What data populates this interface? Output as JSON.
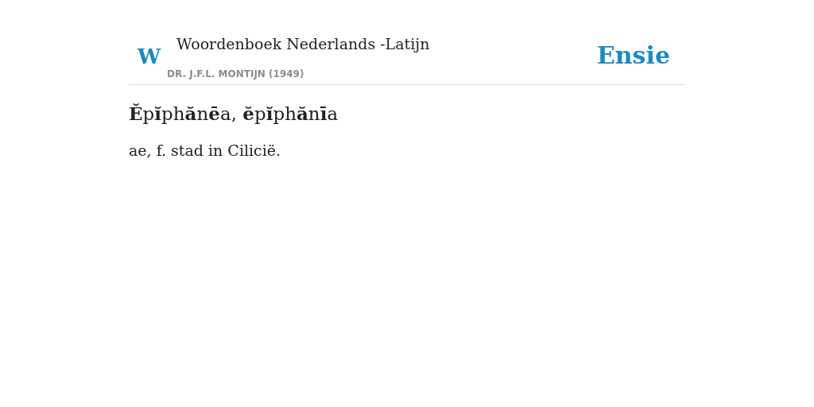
{
  "header": {
    "logo_letter": "W",
    "title": "Woordenboek Nederlands -Latijn",
    "author": "DR. J.F.L. MONTIJN (1949)",
    "brand": "Ensie"
  },
  "entry": {
    "headword": "**Ĕ**p**ĭ**ph**ă**n**ē**a, **ĕ**p**ĭ**ph**ă**n**ī**a",
    "definition": "ae, f. stad in Ciliciё."
  }
}
